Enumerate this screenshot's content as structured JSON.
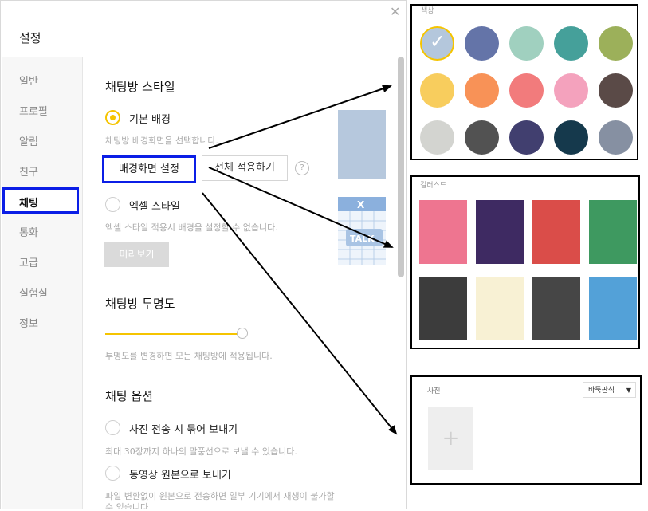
{
  "window": {
    "title": "설정",
    "close_icon": "close-icon"
  },
  "sidebar": {
    "items": [
      {
        "label": "일반"
      },
      {
        "label": "프로필"
      },
      {
        "label": "알림"
      },
      {
        "label": "친구"
      },
      {
        "label": "채팅",
        "active": true
      },
      {
        "label": "통화"
      },
      {
        "label": "고급"
      },
      {
        "label": "실험실"
      },
      {
        "label": "정보"
      }
    ]
  },
  "chat_style": {
    "heading": "채팅방 스타일",
    "basic": {
      "label": "기본 배경",
      "desc": "채팅방 배경화면을 선택합니다.",
      "selected": true
    },
    "bg_button": "배경화면 설정",
    "apply_all_button": "전체 적용하기",
    "help": "?",
    "excel": {
      "label": "엑셀 스타일",
      "desc": "엑셀 스타일 적용시 배경을 설정할 수 없습니다.",
      "selected": false
    },
    "preview_button": "미리보기"
  },
  "transparency": {
    "heading": "채팅방 투명도",
    "desc": "투명도를 변경하면 모든 채팅방에 적용됩니다.",
    "level": 1.0
  },
  "chat_options": {
    "heading": "채팅 옵션",
    "photo_bundle": {
      "label": "사진 전송 시 묶어 보내기",
      "desc": "최대 30장까지 하나의 말풍선으로 보낼 수 있습니다."
    },
    "video_original": {
      "label": "동영상 원본으로 보내기",
      "desc1": "파일 변환없이 원본으로 전송하면 일부 기기에서 재생이 불가할",
      "desc2": "수 있습니다."
    }
  },
  "color_panel": {
    "label": "색상",
    "colors": [
      "#b4c7dc",
      "#6474a8",
      "#a0d0bf",
      "#45a09a",
      "#9cb05a",
      "#f8cd5d",
      "#f89257",
      "#f27b7c",
      "#f4a2bd",
      "#5a4a47",
      "#d3d4d0",
      "#525252",
      "#413f6f",
      "#15394c",
      "#8690a2"
    ],
    "selected_index": 0
  },
  "wallpaper_panel": {
    "label": "컬러스드",
    "wallpapers": [
      "#ee7590",
      "#3e2a62",
      "#da4d49",
      "#3e9960",
      "#3c3c3c",
      "#f8f1d4",
      "#464646",
      "#53a1d8"
    ]
  },
  "photo_panel": {
    "label": "사진",
    "sort_label": "바둑판식",
    "add_icon": "+"
  }
}
